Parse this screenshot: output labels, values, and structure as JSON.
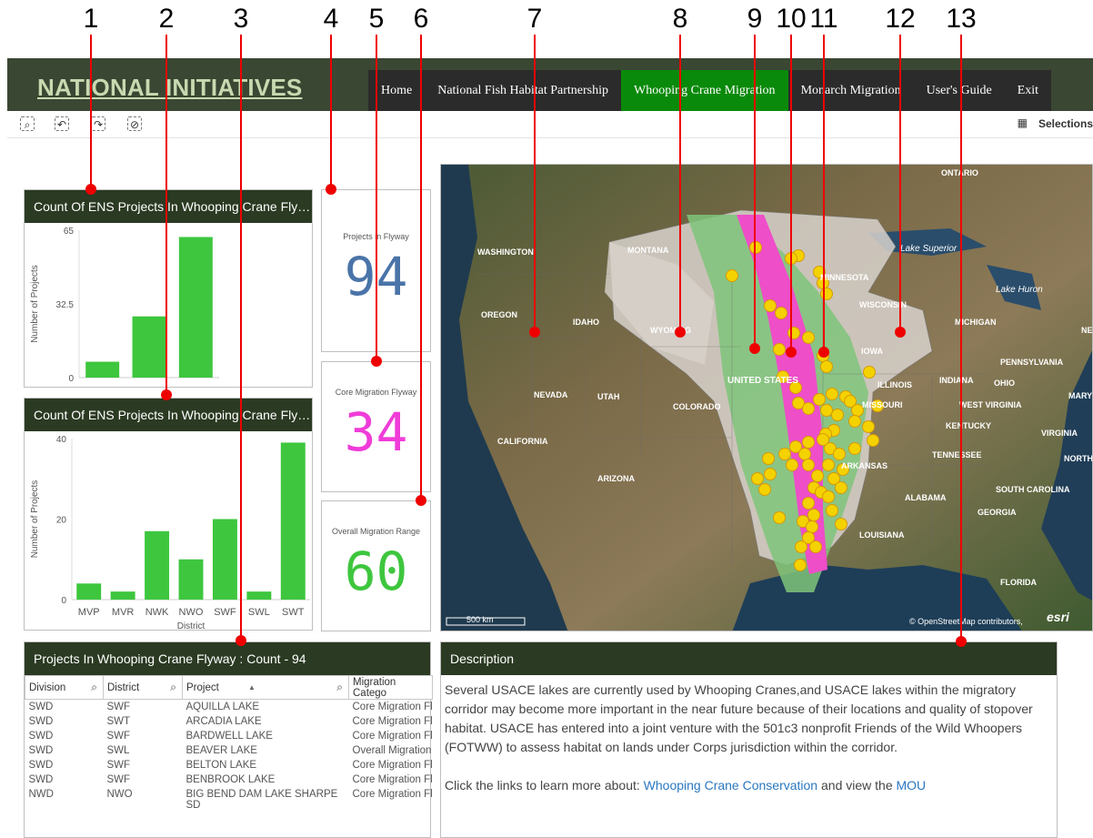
{
  "callouts": [
    "1",
    "2",
    "3",
    "4",
    "5",
    "6",
    "7",
    "8",
    "9",
    "10",
    "11",
    "12",
    "13"
  ],
  "header": {
    "title": "NATIONAL INITIATIVES",
    "nav": [
      "Home",
      "National Fish Habitat Partnership",
      "Whooping Crane Migration",
      "Monarch Migration",
      "User's Guide",
      "Exit"
    ],
    "active_nav": "Whooping Crane Migration"
  },
  "toolbar": {
    "selections_label": "Selections",
    "icons": [
      "smart-search-icon",
      "step-back-icon",
      "step-forward-icon",
      "clear-selections-icon",
      "selections-grid-icon"
    ]
  },
  "chart1": {
    "title": "Count Of ENS Projects In Whooping Crane Flywa...",
    "chart_data": {
      "type": "bar",
      "categories": [
        "",
        "",
        ""
      ],
      "values": [
        7,
        27,
        62
      ],
      "ylabel": "Number of Projects",
      "yticks": [
        "0",
        "32.5",
        "65"
      ],
      "ylim": [
        0,
        65
      ],
      "color": "#3ec63e"
    }
  },
  "chart2": {
    "title": "Count Of ENS Projects In Whooping Crane Flywa...",
    "chart_data": {
      "type": "bar",
      "categories": [
        "MVP",
        "MVR",
        "NWK",
        "NWO",
        "SWF",
        "SWL",
        "SWT"
      ],
      "values": [
        4,
        2,
        17,
        10,
        20,
        2,
        39
      ],
      "xlabel": "District",
      "ylabel": "Number of Projects",
      "yticks": [
        "0",
        "20",
        "40"
      ],
      "ylim": [
        0,
        40
      ],
      "color": "#3ec63e"
    }
  },
  "kpis": [
    {
      "label": "Projects in Flyway",
      "value": "94",
      "color": "#4a74a8"
    },
    {
      "label": "Core Migration Flyway",
      "value": "34",
      "color": "#f03cd8"
    },
    {
      "label": "Overall Migration Range",
      "value": "60",
      "color": "#3ec63e"
    }
  ],
  "map": {
    "labels": [
      {
        "text": "ONTARIO"
      },
      {
        "text": "Lake Superior"
      },
      {
        "text": "WASHINGTON"
      },
      {
        "text": "MONTANA"
      },
      {
        "text": "MINNESOTA"
      },
      {
        "text": "Lake Huron"
      },
      {
        "text": "WISCONSIN"
      },
      {
        "text": "OREGON"
      },
      {
        "text": "IDAHO"
      },
      {
        "text": "WYOMING"
      },
      {
        "text": "MICHIGAN"
      },
      {
        "text": "NEW"
      },
      {
        "text": "IOWA"
      },
      {
        "text": "PENNSYLVANIA"
      },
      {
        "text": "UNITED STATES"
      },
      {
        "text": "ILLINOIS"
      },
      {
        "text": "INDIANA"
      },
      {
        "text": "OHIO"
      },
      {
        "text": "NEVADA"
      },
      {
        "text": "UTAH"
      },
      {
        "text": "COLORADO"
      },
      {
        "text": "MISSOURI"
      },
      {
        "text": "WEST VIRGINIA"
      },
      {
        "text": "MARYL"
      },
      {
        "text": "KENTUCKY"
      },
      {
        "text": "VIRGINIA"
      },
      {
        "text": "CALIFORNIA"
      },
      {
        "text": "TENNESSEE"
      },
      {
        "text": "NORTH"
      },
      {
        "text": "ARKANSAS"
      },
      {
        "text": "ARIZONA"
      },
      {
        "text": "ALABAMA"
      },
      {
        "text": "SOUTH CAROLINA"
      },
      {
        "text": "GEORGIA"
      },
      {
        "text": "LOUISIANA"
      },
      {
        "text": "FLORIDA"
      }
    ],
    "scale_label": "500 km",
    "attribution": "© OpenStreetMap contributors,",
    "logo": "esri"
  },
  "table": {
    "title": "Projects In Whooping Crane Flyway : Count - 94",
    "columns": [
      "Division",
      "District",
      "Project",
      "Migration Catego"
    ],
    "rows": [
      [
        "SWD",
        "SWF",
        "AQUILLA LAKE",
        "Core Migration Fl"
      ],
      [
        "SWD",
        "SWT",
        "ARCADIA LAKE",
        "Core Migration Fl"
      ],
      [
        "SWD",
        "SWF",
        "BARDWELL LAKE",
        "Core Migration Fl"
      ],
      [
        "SWD",
        "SWL",
        "BEAVER LAKE",
        "Overall Migration"
      ],
      [
        "SWD",
        "SWF",
        "BELTON LAKE",
        "Core Migration Fl"
      ],
      [
        "SWD",
        "SWF",
        "BENBROOK LAKE",
        "Core Migration Fl"
      ],
      [
        "NWD",
        "NWO",
        "BIG BEND DAM LAKE SHARPE SD",
        "Core Migration Fl"
      ]
    ]
  },
  "description": {
    "title": "Description",
    "paragraph1": "Several USACE lakes are currently used by Whooping Cranes,and USACE lakes within the migratory corridor may become more important in the near future because of their locations and quality of stopover habitat. USACE has entered into a joint venture with the 501c3 nonprofit Friends of the Wild Whoopers (FOTWW) to assess habitat on lands under Corps jurisdiction within the corridor.",
    "p2_prefix": "Click the links to learn more about: ",
    "link1": "Whooping Crane Conservation",
    "p2_middle": " and view the ",
    "link2": "MOU"
  }
}
